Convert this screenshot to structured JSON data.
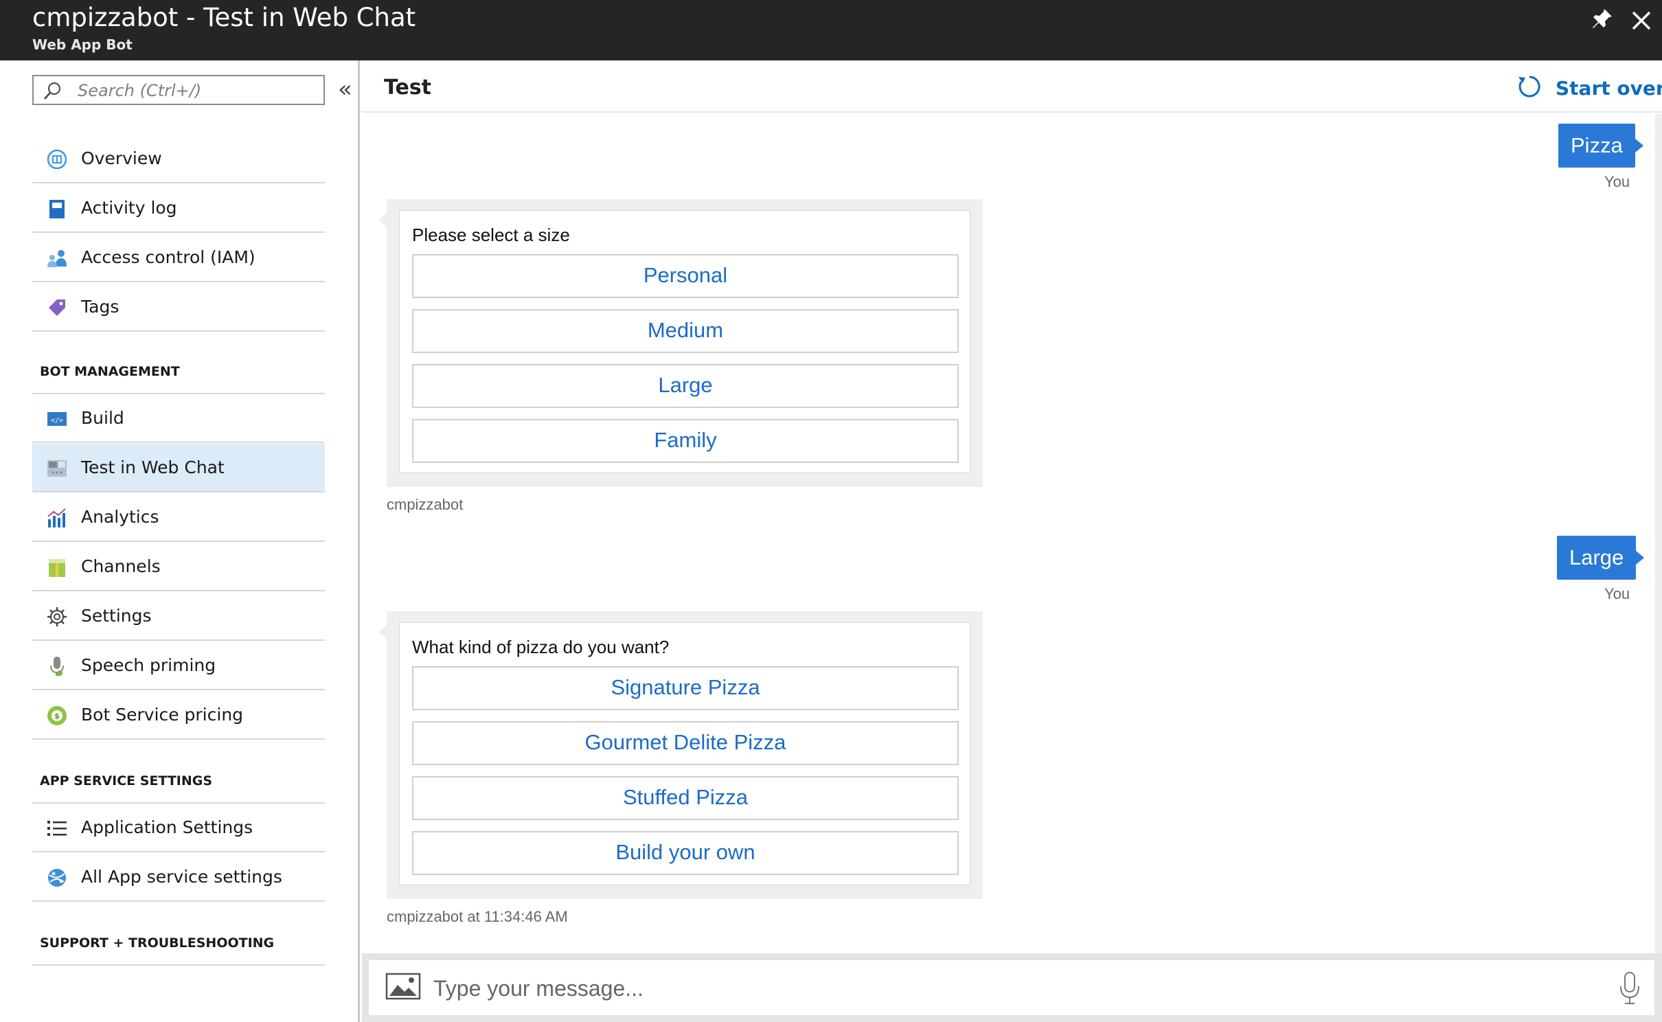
{
  "window": {
    "title": "cmpizzabot - Test in Web Chat",
    "subtitle": "Web App Bot",
    "pin_icon": "pin-icon",
    "close_icon": "close-icon"
  },
  "sidebar": {
    "search_placeholder": "Search (Ctrl+/)",
    "collapse_glyph": "«",
    "items_top": [
      {
        "label": "Overview",
        "icon": "overview-icon"
      },
      {
        "label": "Activity log",
        "icon": "activity-log-icon"
      },
      {
        "label": "Access control (IAM)",
        "icon": "access-control-icon"
      },
      {
        "label": "Tags",
        "icon": "tag-icon"
      }
    ],
    "section_bot_management": "BOT MANAGEMENT",
    "items_bot": [
      {
        "label": "Build",
        "icon": "build-icon"
      },
      {
        "label": "Test in Web Chat",
        "icon": "web-chat-icon",
        "active": true
      },
      {
        "label": "Analytics",
        "icon": "analytics-icon"
      },
      {
        "label": "Channels",
        "icon": "channels-icon"
      },
      {
        "label": "Settings",
        "icon": "gear-icon"
      },
      {
        "label": "Speech priming",
        "icon": "microphone-icon"
      },
      {
        "label": "Bot Service pricing",
        "icon": "pricing-icon"
      }
    ],
    "section_app_service": "APP SERVICE SETTINGS",
    "items_app": [
      {
        "label": "Application Settings",
        "icon": "list-icon"
      },
      {
        "label": "All App service settings",
        "icon": "app-service-icon"
      }
    ],
    "section_support": "SUPPORT + TROUBLESHOOTING"
  },
  "main": {
    "title": "Test",
    "start_over": "Start over"
  },
  "chat": {
    "messages": [
      {
        "from": "user",
        "text": "Pizza",
        "label": "You"
      },
      {
        "from": "bot",
        "question": "Please select a size",
        "options": [
          "Personal",
          "Medium",
          "Large",
          "Family"
        ],
        "meta": "cmpizzabot"
      },
      {
        "from": "user",
        "text": "Large",
        "label": "You"
      },
      {
        "from": "bot",
        "question": "What kind of pizza do you want?",
        "options": [
          "Signature Pizza",
          "Gourmet Delite Pizza",
          "Stuffed Pizza",
          "Build your own"
        ],
        "meta": "cmpizzabot at 11:34:46 AM"
      }
    ],
    "input_placeholder": "Type your message..."
  },
  "colors": {
    "titlebar": "#252526",
    "accent": "#2b79d6",
    "link": "#1b6cc8",
    "active_nav": "#dcebf8"
  }
}
